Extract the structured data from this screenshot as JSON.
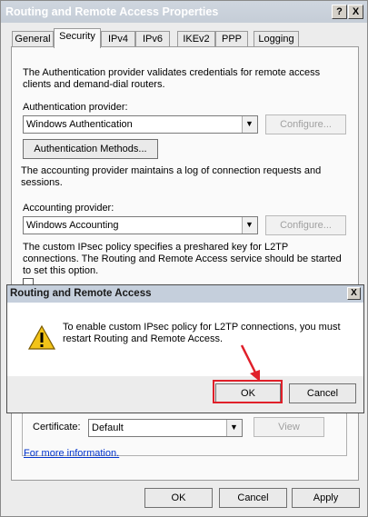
{
  "window": {
    "title": "Routing and Remote Access Properties",
    "help_glyph": "?",
    "close_glyph": "X"
  },
  "tabs": [
    {
      "label": "General",
      "selected": false
    },
    {
      "label": "Security",
      "selected": true
    },
    {
      "label": "IPv4",
      "selected": false
    },
    {
      "label": "IPv6",
      "selected": false
    },
    {
      "label": "IKEv2",
      "selected": false
    },
    {
      "label": "PPP",
      "selected": false
    },
    {
      "label": "Logging",
      "selected": false
    }
  ],
  "security": {
    "auth_desc": "The Authentication provider validates credentials for remote access clients and demand-dial routers.",
    "auth_provider_label": "Authentication provider:",
    "auth_provider_value": "Windows Authentication",
    "configure_label": "Configure...",
    "auth_methods_label": "Authentication Methods...",
    "acct_desc": "The accounting provider maintains a log of connection requests and sessions.",
    "acct_provider_label": "Accounting provider:",
    "acct_provider_value": "Windows Accounting",
    "ipsec_desc": "The custom IPsec policy specifies a preshared key for L2TP connections. The Routing and Remote Access service should be started to set this option.",
    "certificate_label": "Certificate:",
    "certificate_value": "Default",
    "view_label": "View",
    "more_info_link": "For more information."
  },
  "footer": {
    "ok_label": "OK",
    "cancel_label": "Cancel",
    "apply_label": "Apply"
  },
  "dialog": {
    "title": "Routing and Remote Access",
    "close_glyph": "X",
    "message": "To enable custom IPsec policy for L2TP connections, you must restart Routing and Remote Access.",
    "ok_label": "OK",
    "cancel_label": "Cancel"
  },
  "colors": {
    "highlight": "#e0202a",
    "link": "#0033cc"
  },
  "icons": [
    "warning-icon",
    "dropdown-arrow-icon",
    "pointer-arrow-icon"
  ]
}
